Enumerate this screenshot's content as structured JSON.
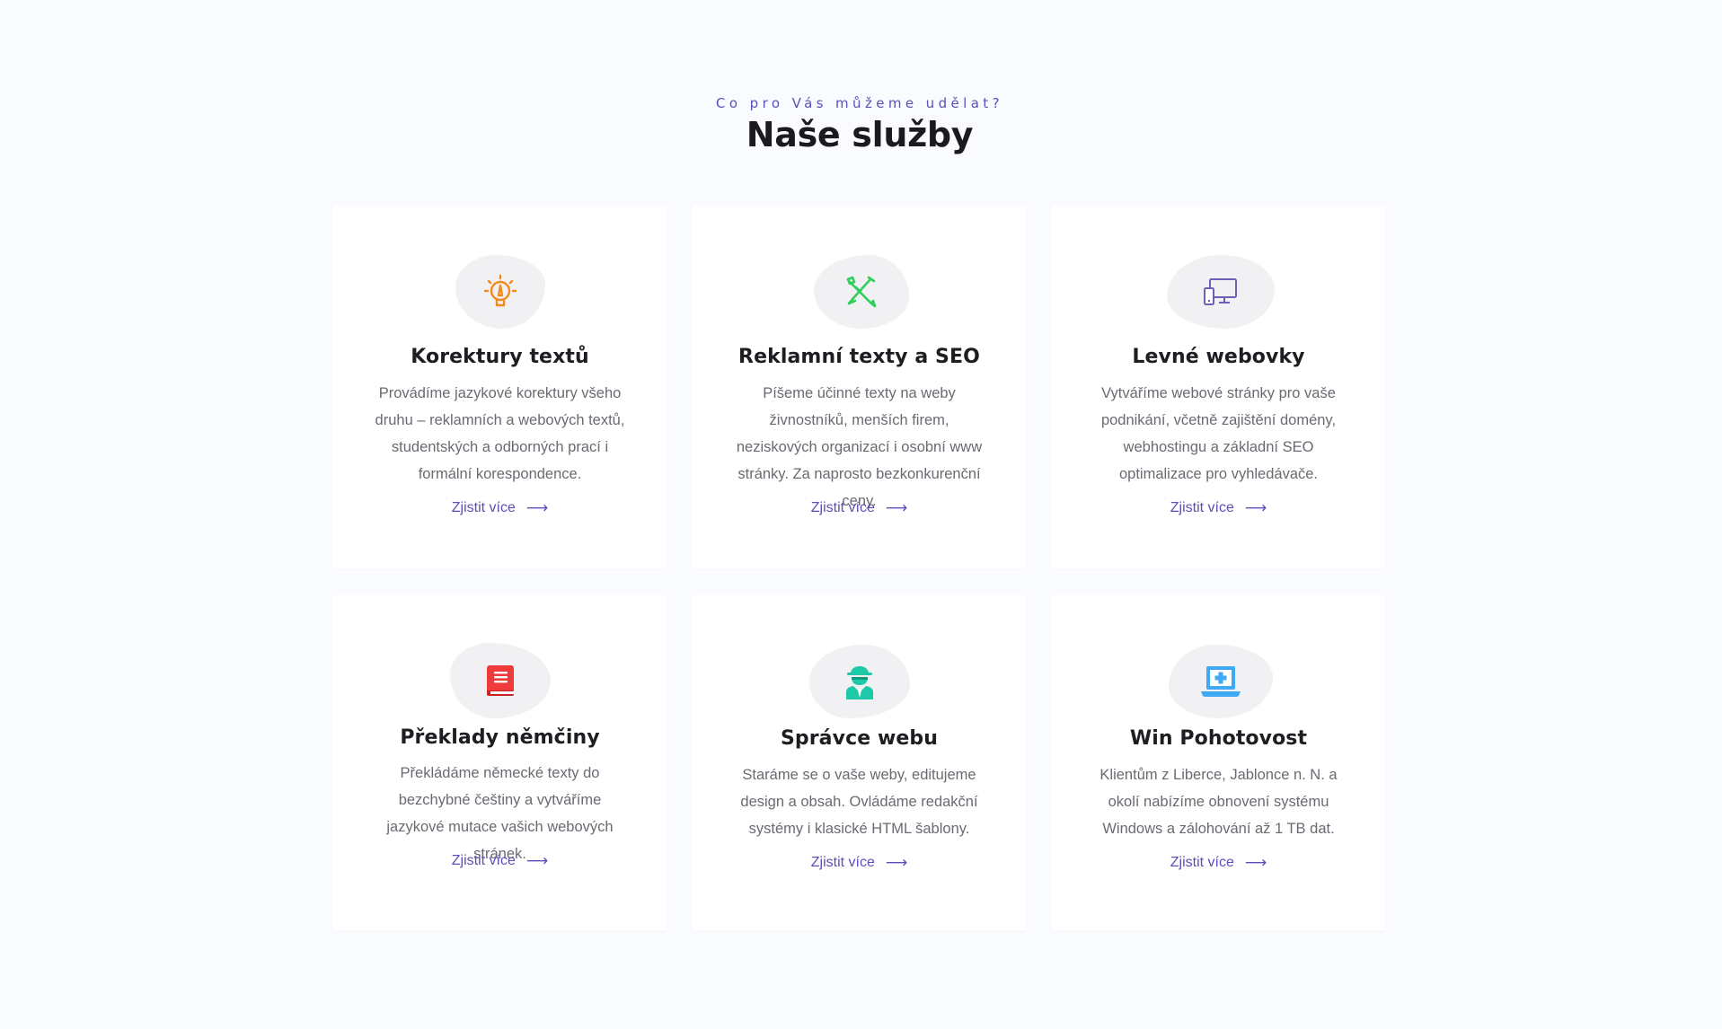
{
  "header": {
    "eyebrow": "Co pro Vás můžeme udělat?",
    "title": "Naše služby"
  },
  "colors": {
    "accent": "#5b4fb8",
    "orange": "#f28b1c",
    "green": "#2fcf5c",
    "purple": "#6b5fb8",
    "red": "#ef3b3b",
    "teal": "#1ec9a7",
    "blue": "#3fa9f5"
  },
  "services": [
    {
      "icon": "lightbulb-pen-icon",
      "title": "Korektury textů",
      "description": "Provádíme jazykové korektury všeho druhu – reklamních a webových textů, studentských a odborných prací i formální korespondence.",
      "link": "Zjistit více",
      "arrow": "⟶"
    },
    {
      "icon": "pencil-tools-icon",
      "title": "Reklamní texty a SEO",
      "description": "Píšeme účinné texty na weby živnostníků, menších firem, neziskových organizací i osobní www stránky. Za naprosto bezkonkurenční ceny.",
      "link": "Zjistit více",
      "arrow": "⟶"
    },
    {
      "icon": "devices-icon",
      "title": "Levné webovky",
      "description": "Vytváříme webové stránky pro vaše podnikání, včetně zajištění domény, webhostingu a základní SEO optimalizace pro vyhledávače.",
      "link": "Zjistit více",
      "arrow": "⟶"
    },
    {
      "icon": "book-icon",
      "title": "Překlady němčiny",
      "description": "Překládáme německé texty do bezchybné češtiny a vytváříme jazykové mutace vašich webových stránek.",
      "link": "Zjistit více",
      "arrow": "⟶"
    },
    {
      "icon": "spy-agent-icon",
      "title": "Správce webu",
      "description": "Staráme se o vaše weby,  editujeme design a obsah. Ovládáme redakční systémy i klasické HTML šablony.",
      "link": "Zjistit více",
      "arrow": "⟶"
    },
    {
      "icon": "laptop-medical-icon",
      "title": "Win Pohotovost",
      "description": "Klientům z Liberce, Jablonce n. N. a okolí nabízíme obnovení systému Windows a zálohování až 1 TB dat.",
      "link": "Zjistit více",
      "arrow": "⟶"
    }
  ]
}
